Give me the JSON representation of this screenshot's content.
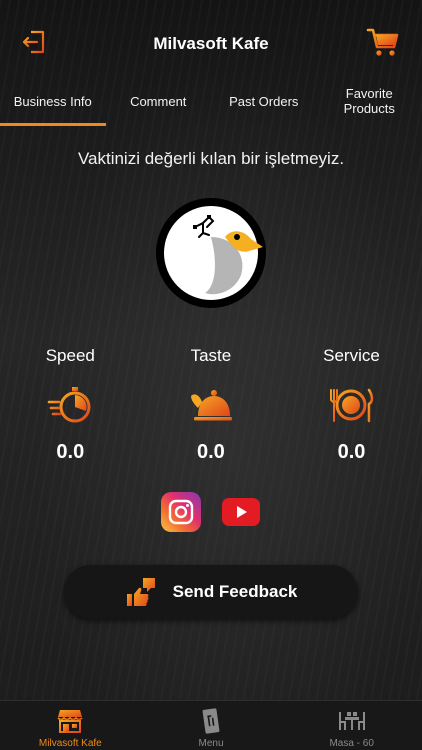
{
  "header": {
    "title": "Milvasoft Kafe",
    "logout_icon": "logout-icon",
    "cart_icon": "cart-icon"
  },
  "tabs": [
    {
      "label": "Business Info",
      "active": true
    },
    {
      "label": "Comment",
      "active": false
    },
    {
      "label": "Past Orders",
      "active": false
    },
    {
      "label": "Favorite Products",
      "active": false
    }
  ],
  "slogan": "Vaktinizi değerli kılan bir işletmeyiz.",
  "stats": [
    {
      "label": "Speed",
      "value": "0.0",
      "icon": "stopwatch-icon"
    },
    {
      "label": "Taste",
      "value": "0.0",
      "icon": "food-cloche-icon"
    },
    {
      "label": "Service",
      "value": "0.0",
      "icon": "plate-cutlery-icon"
    }
  ],
  "social": {
    "instagram_icon": "instagram-icon",
    "youtube_icon": "youtube-icon"
  },
  "feedback": {
    "label": "Send Feedback",
    "icon": "thumbs-feedback-icon"
  },
  "bottom_nav": [
    {
      "label": "Milvasoft Kafe",
      "icon": "store-icon",
      "active": true
    },
    {
      "label": "Menu",
      "icon": "menu-icon",
      "active": false
    },
    {
      "label": "Masa - 60",
      "icon": "table-icon",
      "active": false
    }
  ],
  "colors": {
    "accent": "#f08a1c",
    "accent_red": "#e0461a"
  }
}
